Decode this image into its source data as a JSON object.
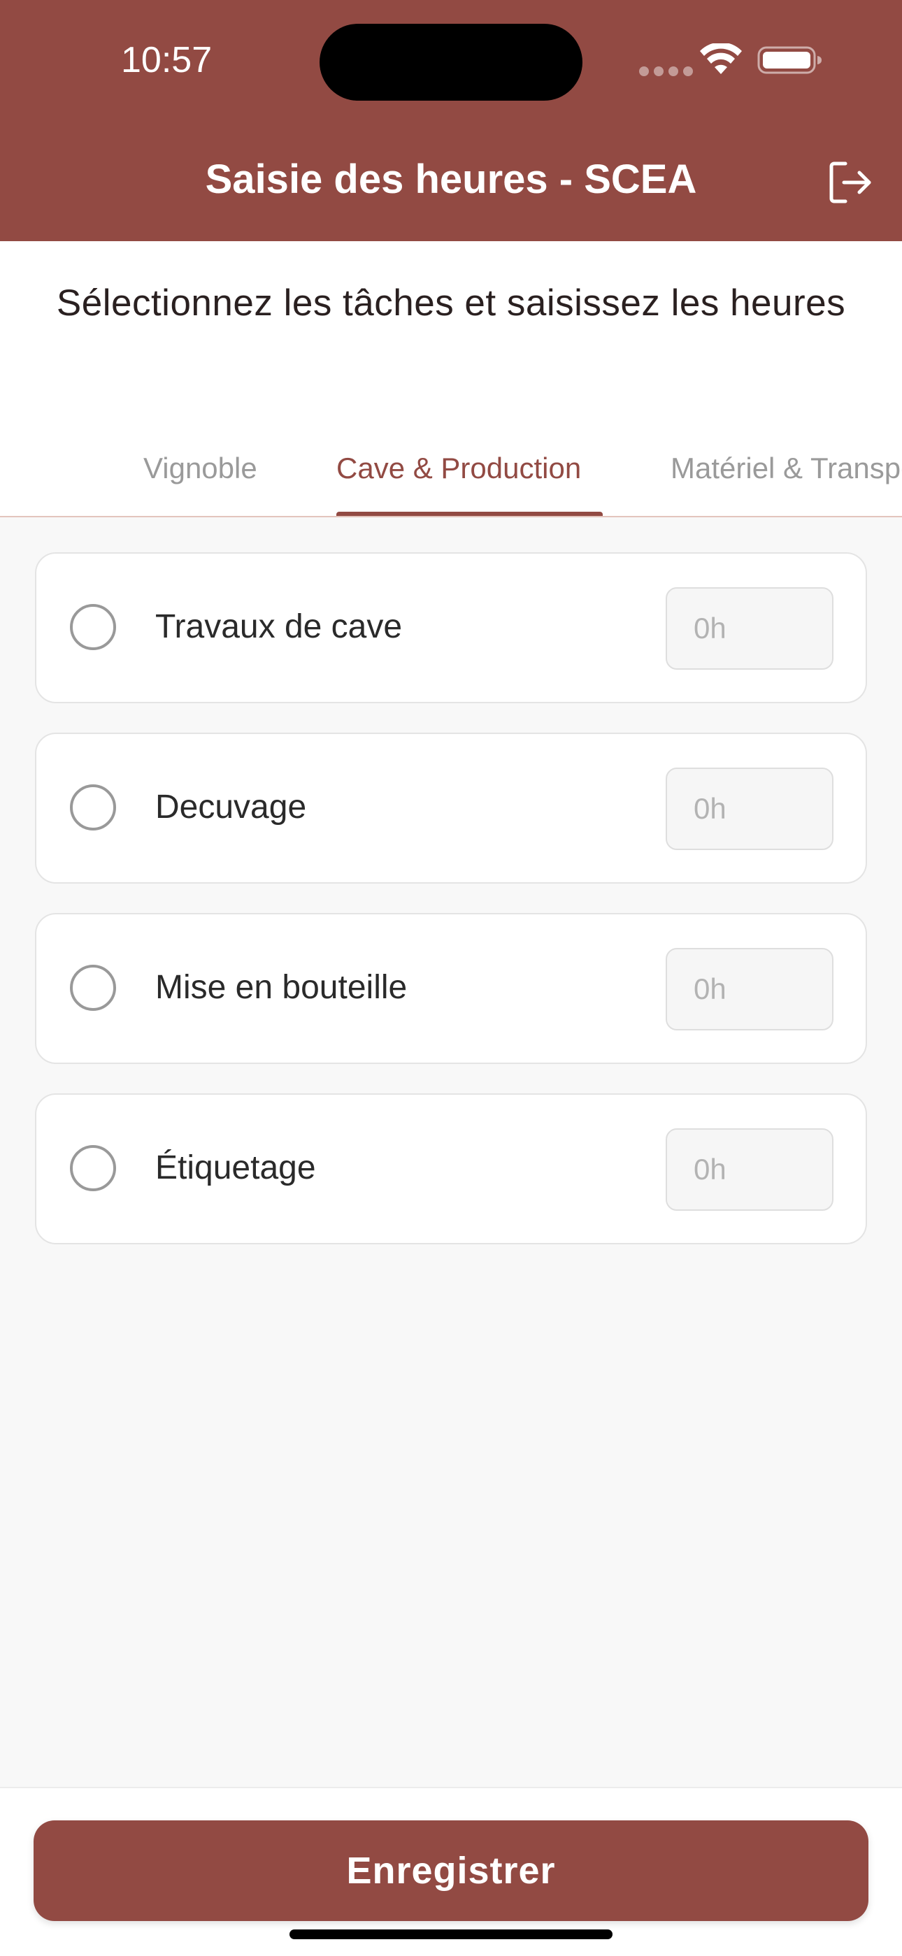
{
  "status_bar": {
    "time": "10:57",
    "icons": [
      "signal-dots-icon",
      "wifi-icon",
      "battery-icon"
    ]
  },
  "header": {
    "title": "Saisie des heures - SCEA",
    "logout_icon": "logout-icon"
  },
  "instruction": "Sélectionnez les tâches et saisissez les heures",
  "tabs": [
    {
      "label": "Vignoble",
      "active": false
    },
    {
      "label": "Cave & Production",
      "active": true
    },
    {
      "label": "Matériel & Transport",
      "active": false
    }
  ],
  "tasks": [
    {
      "label": "Travaux de cave",
      "hours_placeholder": "0h",
      "hours_value": ""
    },
    {
      "label": "Decuvage",
      "hours_placeholder": "0h",
      "hours_value": ""
    },
    {
      "label": "Mise en bouteille",
      "hours_placeholder": "0h",
      "hours_value": ""
    },
    {
      "label": "Étiquetage",
      "hours_placeholder": "0h",
      "hours_value": ""
    }
  ],
  "footer": {
    "save_label": "Enregistrer"
  },
  "colors": {
    "primary": "#924a43",
    "background": "#f8f8f8",
    "card": "#ffffff"
  }
}
